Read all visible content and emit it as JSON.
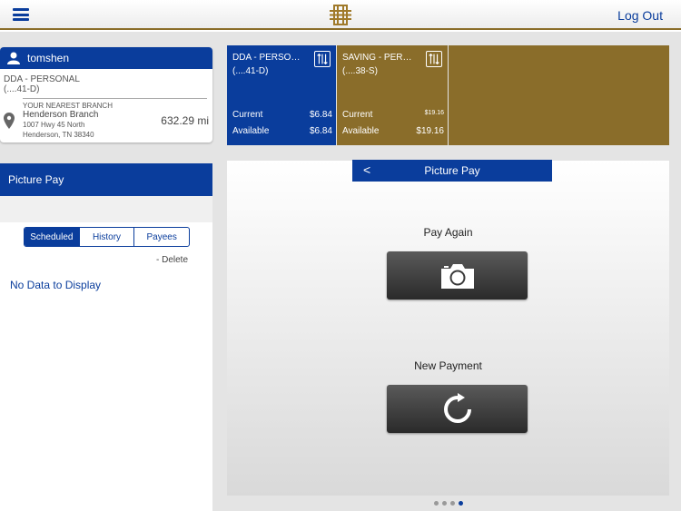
{
  "header": {
    "logout_label": "Log Out"
  },
  "user": {
    "name": "tomshen",
    "account_name": "DDA - PERSONAL",
    "account_number": "(....41-D)",
    "branch_label": "YOUR NEAREST BRANCH",
    "branch_name": "Henderson Branch",
    "branch_address1": "1007 Hwy 45 North",
    "branch_address2": "Henderson, TN 38340",
    "distance": "632.29 mi"
  },
  "sidebar": {
    "title": "Picture Pay",
    "tabs": [
      "Scheduled",
      "History",
      "Payees"
    ],
    "delete_label": "- Delete",
    "empty_text": "No Data to Display"
  },
  "accounts": [
    {
      "name": "DDA - PERSO…",
      "number": "(....41-D)",
      "current_label": "Current",
      "current": "$6.84",
      "available_label": "Available",
      "available": "$6.84"
    },
    {
      "name": "SAVING - PER…",
      "number": "(....38-S)",
      "current_label": "Current",
      "current": "$19.16",
      "available_label": "Available",
      "available": "$19.16"
    }
  ],
  "main": {
    "back_label": "<",
    "title": "Picture Pay",
    "pay_again_label": "Pay Again",
    "new_payment_label": "New Payment"
  },
  "pager": {
    "total": 4,
    "active": 3
  },
  "colors": {
    "primary": "#0a3d9c",
    "gold": "#8a6d2a"
  }
}
